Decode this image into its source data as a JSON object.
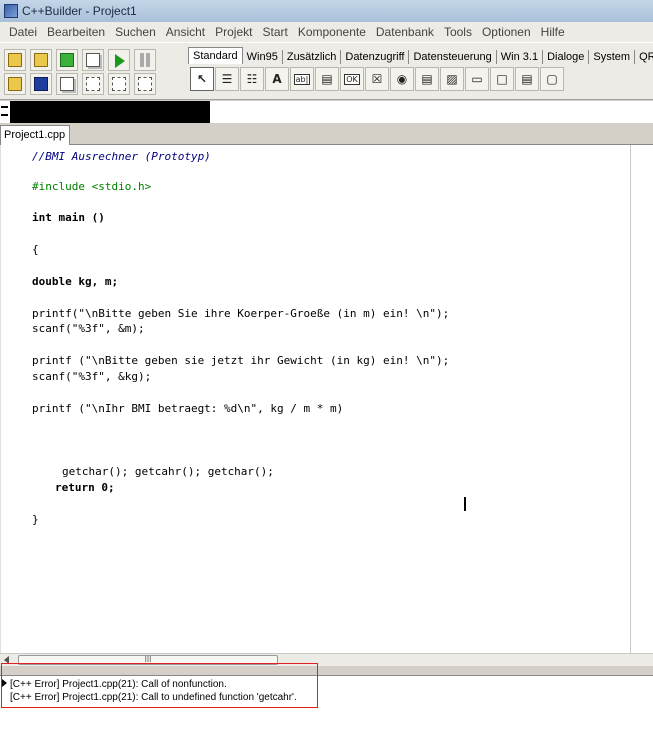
{
  "window": {
    "title": "C++Builder - Project1"
  },
  "menu": [
    "Datei",
    "Bearbeiten",
    "Suchen",
    "Ansicht",
    "Projekt",
    "Start",
    "Komponente",
    "Datenbank",
    "Tools",
    "Optionen",
    "Hilfe"
  ],
  "palette": {
    "tabs": [
      "Standard",
      "Win95",
      "Zusätzlich",
      "Datenzugriff",
      "Datensteuerung",
      "Win 3.1",
      "Dialoge",
      "System",
      "QRepo"
    ],
    "active_tab": "Standard",
    "component_label": "A",
    "edit_label": "ab|",
    "ok_label": "OK"
  },
  "editor": {
    "file_tab": "Project1.cpp",
    "lines": [
      "//BMI Ausrechner (Prototyp)",
      "#include <stdio.h>",
      "int main ()",
      "{",
      "double kg, m;",
      "printf(\"\\nBitte geben Sie ihre Koerper-Groeße (in m) ein! \\n\");",
      "scanf(\"%3f\", &m);",
      "printf (\"\\nBitte geben sie jetzt ihr Gewicht (in kg) ein! \\n\");",
      "scanf(\"%3f\", &kg);",
      "printf (\"\\nIhr BMI betraegt: %d\\n\", kg / m * m)",
      "getchar(); getcahr(); getchar();",
      "return 0;",
      "}"
    ]
  },
  "messages": [
    "[C++ Error] Project1.cpp(21): Call of nonfunction.",
    "[C++ Error] Project1.cpp(21): Call to undefined function 'getcahr'."
  ],
  "scrollbar": {
    "thumb_grip": "III"
  }
}
